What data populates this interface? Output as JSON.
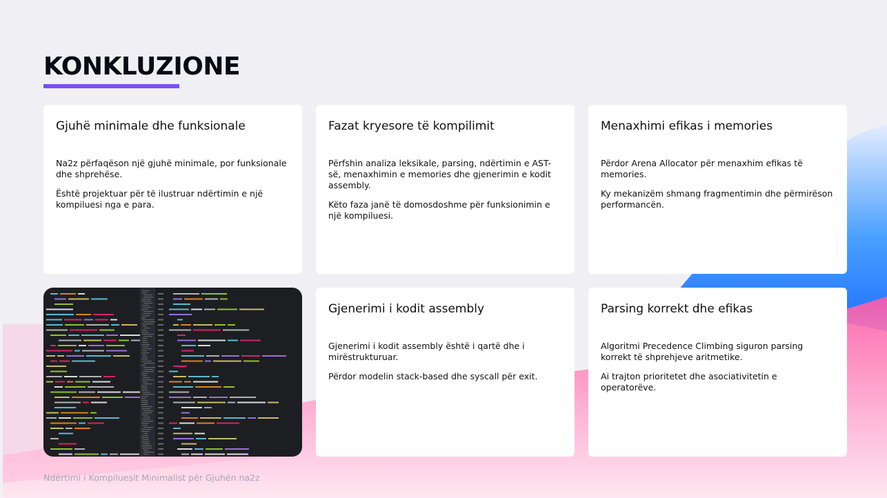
{
  "slide": {
    "title": "KONKLUZIONE",
    "accent_color": "#7c4dff",
    "footer": "Ndërtimi i Kompiluesit Minimalist për Gjuhën na2z"
  },
  "cards": [
    {
      "title": "Gjuhë minimale dhe funksionale",
      "paragraphs": [
        "Na2z përfaqëson një gjuhë minimale, por funksionale dhe shprehëse.",
        "Është projektuar për të ilustruar ndërtimin e një kompiluesi nga e para."
      ]
    },
    {
      "title": "Fazat kryesore të kompilimit",
      "paragraphs": [
        "Përfshin analiza leksikale, parsing, ndërtimin e AST-së, menaxhimin e memories dhe gjenerimin e kodit assembly.",
        "Këto faza janë të domosdoshme për funksionimin e një kompiluesi."
      ]
    },
    {
      "title": "Menaxhimi efikas i memories",
      "paragraphs": [
        "Përdor Arena Allocator për menaxhim efikas të memories.",
        "Ky mekanizëm shmang fragmentimin dhe përmirëson performancën."
      ]
    },
    {
      "title": "Gjenerimi i kodit assembly",
      "paragraphs": [
        "Gjenerimi i kodit assembly është i qartë dhe i mirëstrukturuar.",
        "Përdor modelin stack-based dhe syscall për exit."
      ]
    },
    {
      "title": "Parsing korrekt dhe efikas",
      "paragraphs": [
        "Algoritmi Precedence Climbing siguron parsing korrekt të shprehjeve aritmetike.",
        "Ai trajton prioritetet dhe asociativitetin e operatorëve."
      ]
    }
  ],
  "code_image": {
    "icon": "code-screenshot",
    "background": "#1d1e22"
  }
}
